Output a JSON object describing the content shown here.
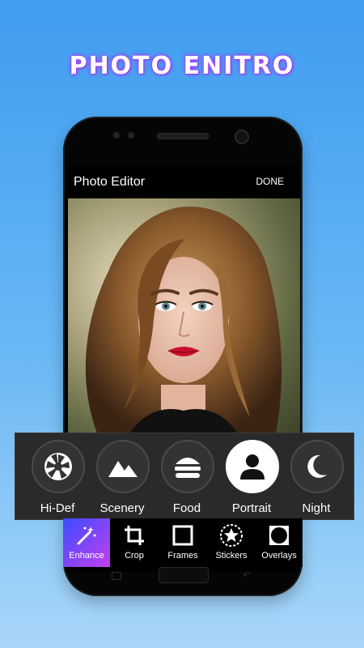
{
  "promo": {
    "title": "PHOTO ENITRO"
  },
  "app_bar": {
    "title": "Photo Editor",
    "done_label": "DONE"
  },
  "filters": [
    {
      "label": "Hi-Def",
      "icon": "aperture-icon",
      "active": false
    },
    {
      "label": "Scenery",
      "icon": "mountains-icon",
      "active": false
    },
    {
      "label": "Food",
      "icon": "burger-icon",
      "active": false
    },
    {
      "label": "Portrait",
      "icon": "person-icon",
      "active": true
    },
    {
      "label": "Night",
      "icon": "moon-icon",
      "active": false
    }
  ],
  "toolbar": [
    {
      "label": "Enhance",
      "icon": "magic-wand-icon",
      "active": true
    },
    {
      "label": "Crop",
      "icon": "crop-icon",
      "active": false
    },
    {
      "label": "Frames",
      "icon": "frame-icon",
      "active": false
    },
    {
      "label": "Stickers",
      "icon": "star-sticker-icon",
      "active": false
    },
    {
      "label": "Overlays",
      "icon": "overlay-icon",
      "active": false
    }
  ],
  "colors": {
    "background_top": "#3f9cf0",
    "background_bottom": "#a9d6f8",
    "title_glow": "#c33cff",
    "active_gradient_start": "#3b4cff",
    "active_gradient_end": "#c43ff0"
  }
}
